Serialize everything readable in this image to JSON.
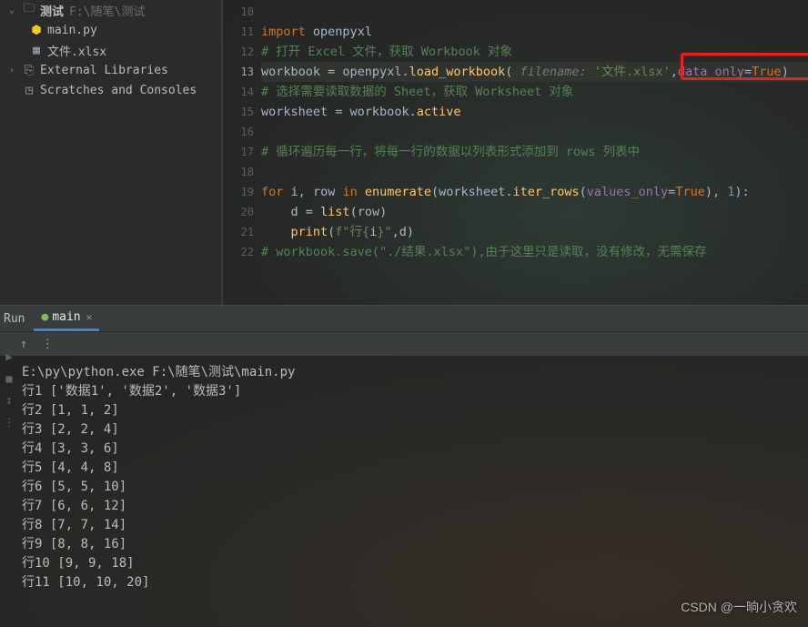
{
  "sidebar": {
    "root": {
      "arrow": "⌄",
      "label": "测试",
      "hint": "F:\\随笔\\测试"
    },
    "files": [
      {
        "icon": "py",
        "label": "main.py"
      },
      {
        "icon": "xlsx",
        "label": "文件.xlsx"
      }
    ],
    "ext_lib": {
      "arrow": "›",
      "label": "External Libraries"
    },
    "scratch": {
      "label": "Scratches and Consoles"
    }
  },
  "code": {
    "lines": [
      {
        "n": 10,
        "t": ""
      },
      {
        "n": 11,
        "t": "import openpyxl"
      },
      {
        "n": 12,
        "t": "# 打开 Excel 文件，获取 Workbook 对象"
      },
      {
        "n": 13,
        "t": "workbook = openpyxl.load_workbook( filename: '文件.xlsx',data_only=True)"
      },
      {
        "n": 14,
        "t": "# 选择需要读取数据的 Sheet，获取 Worksheet 对象"
      },
      {
        "n": 15,
        "t": "worksheet = workbook.active"
      },
      {
        "n": 16,
        "t": ""
      },
      {
        "n": 17,
        "t": "# 循环遍历每一行，将每一行的数据以列表形式添加到 rows 列表中"
      },
      {
        "n": 18,
        "t": ""
      },
      {
        "n": 19,
        "t": "for i, row in enumerate(worksheet.iter_rows(values_only=True), 1):"
      },
      {
        "n": 20,
        "t": "    d = list(row)"
      },
      {
        "n": 21,
        "t": "    print(f\"行{i}\",d)"
      },
      {
        "n": 22,
        "t": "# workbook.save(\"./结果.xlsx\"),由于这里只是读取，没有修改，无需保存"
      }
    ],
    "caret": 13
  },
  "panel": {
    "section": "Run",
    "tab": "main",
    "toolbar_up": "↑",
    "toolbar_more": "⋮"
  },
  "console": {
    "lines": [
      "E:\\py\\python.exe F:\\随笔\\测试\\main.py",
      "行1 ['数据1', '数据2', '数据3']",
      "行2 [1, 1, 2]",
      "行3 [2, 2, 4]",
      "行4 [3, 3, 6]",
      "行5 [4, 4, 8]",
      "行6 [5, 5, 10]",
      "行7 [6, 6, 12]",
      "行8 [7, 7, 14]",
      "行9 [8, 8, 16]",
      "行10 [9, 9, 18]",
      "行11 [10, 10, 20]"
    ]
  },
  "watermark": "CSDN @一晌小贪欢"
}
